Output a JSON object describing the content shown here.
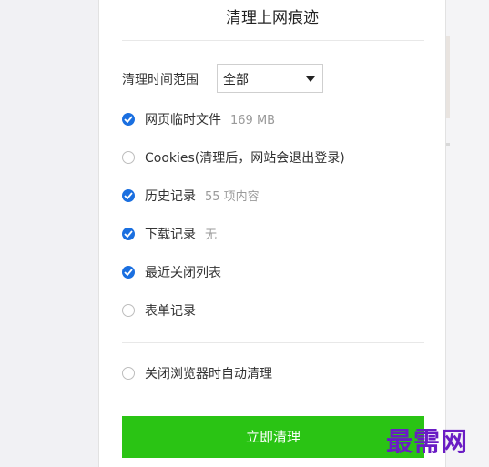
{
  "dialog": {
    "title": "清理上网痕迹",
    "range_label": "清理时间范围",
    "range_value": "全部"
  },
  "options": [
    {
      "label": "网页临时文件",
      "note": "169 MB",
      "checked": true
    },
    {
      "label": "Cookies(清理后，网站会退出登录)",
      "note": "",
      "checked": false
    },
    {
      "label": "历史记录",
      "note": "55 项内容",
      "checked": true
    },
    {
      "label": "下载记录",
      "note": "无",
      "checked": true
    },
    {
      "label": "最近关闭列表",
      "note": "",
      "checked": true
    },
    {
      "label": "表单记录",
      "note": "",
      "checked": false
    }
  ],
  "auto_clear": {
    "label": "关闭浏览器时自动清理",
    "checked": false
  },
  "clear_button": "立即清理",
  "watermark": "最需网",
  "colors": {
    "accent": "#1a6fe0",
    "button": "#2ac414",
    "watermark": "#6a1cc4"
  }
}
